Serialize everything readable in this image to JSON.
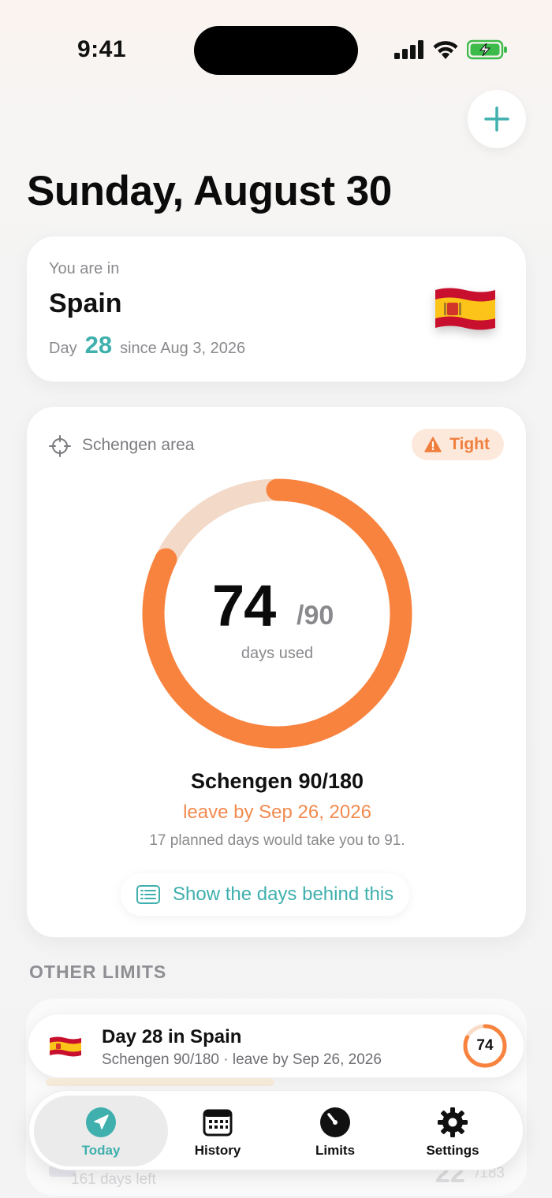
{
  "status_bar": {
    "time": "9:41"
  },
  "header": {
    "date": "Sunday, August 30"
  },
  "location": {
    "prefix": "You are in",
    "country": "Spain",
    "day_prefix": "Day",
    "day_number": "28",
    "since_text": "since Aug 3, 2026"
  },
  "schengen": {
    "zone_label": "Schengen area",
    "status": "Tight",
    "days_used": "74",
    "days_limit": "/90",
    "days_used_label": "days used",
    "progress_fraction": 0.822,
    "rule_name": "Schengen 90/180",
    "leave_by": "leave by Sep 26, 2026",
    "planned_note": "17 planned days would take you to 91.",
    "show_days_label": "Show the days behind this"
  },
  "other_limits": {
    "header": "OTHER LIMITS",
    "ghost_row_text": "161 days left",
    "ghost_value": "22",
    "ghost_max": "/183"
  },
  "live_banner": {
    "title": "Day 28 in Spain",
    "subtitle": "Schengen 90/180 · leave by Sep 26, 2026",
    "ring_value": "74"
  },
  "tabs": [
    {
      "label": "Today",
      "icon": "location-arrow-icon",
      "active": true
    },
    {
      "label": "History",
      "icon": "calendar-icon",
      "active": false
    },
    {
      "label": "Limits",
      "icon": "gauge-icon",
      "active": false
    },
    {
      "label": "Settings",
      "icon": "gear-icon",
      "active": false
    }
  ],
  "colors": {
    "accent_teal": "#3fb0ad",
    "warning_orange": "#f28a4e",
    "badge_bg": "#fde9dc"
  }
}
